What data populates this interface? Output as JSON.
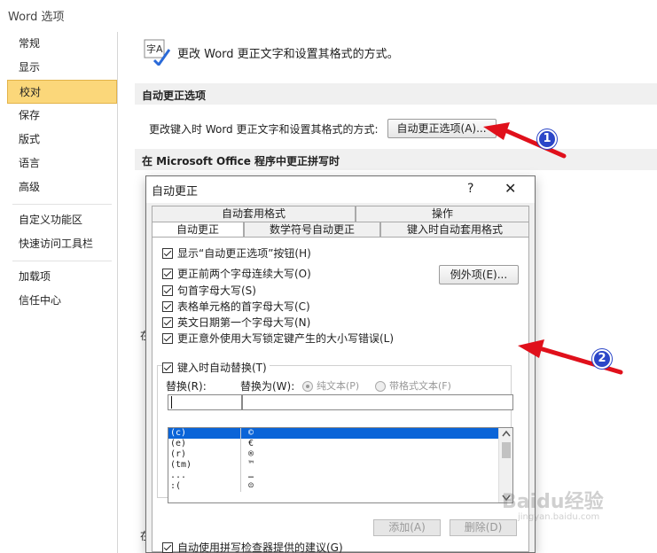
{
  "window": {
    "title": "Word 选项"
  },
  "nav": {
    "items": [
      {
        "label": "常规"
      },
      {
        "label": "显示"
      },
      {
        "label": "校对",
        "selected": true
      },
      {
        "label": "保存"
      },
      {
        "label": "版式"
      },
      {
        "label": "语言"
      },
      {
        "label": "高级"
      }
    ],
    "items2": [
      {
        "label": "自定义功能区"
      },
      {
        "label": "快速访问工具栏"
      }
    ],
    "items3": [
      {
        "label": "加载项"
      },
      {
        "label": "信任中心"
      }
    ]
  },
  "main": {
    "header_text": "更改 Word 更正文字和设置其格式的方式。",
    "icon_text": "字A",
    "section_autocorrect": "自动更正选项",
    "ac_row_label": "更改键入时 Word 更正文字和设置其格式的方式:",
    "ac_button": "自动更正选项(A)...",
    "section_spelling": "在 Microsoft Office 程序中更正拼写时",
    "stray1": "在",
    "stray2": "在"
  },
  "dialog": {
    "title": "自动更正",
    "help": "?",
    "close": "✕",
    "tabs_top": [
      "自动套用格式",
      "操作"
    ],
    "tabs_bottom": [
      "自动更正",
      "数学符号自动更正",
      "键入时自动套用格式"
    ],
    "show_button_label": "显示“自动更正选项”按钮(H)",
    "options": [
      "更正前两个字母连续大写(O)",
      "句首字母大写(S)",
      "表格单元格的首字母大写(C)",
      "英文日期第一个字母大写(N)",
      "更正意外使用大写锁定键产生的大小写错误(L)"
    ],
    "exceptions_button": "例外项(E)...",
    "replace_group_label": "键入时自动替换(T)",
    "replace_label": "替换(R):",
    "with_label": "替换为(W):",
    "radio_plain": "纯文本(P)",
    "radio_formatted": "带格式文本(F)",
    "list_rows": [
      {
        "a": "(c)",
        "b": "©",
        "selected": true
      },
      {
        "a": "(e)",
        "b": "€"
      },
      {
        "a": "(r)",
        "b": "®"
      },
      {
        "a": "(tm)",
        "b": "™"
      },
      {
        "a": "...",
        "b": "…"
      },
      {
        "a": ":(",
        "b": "☹"
      }
    ],
    "add_button": "添加(A)",
    "delete_button": "删除(D)",
    "spell_suggest": "自动使用拼写检查器提供的建议(G)"
  },
  "annotations": {
    "badge1": "1",
    "badge2": "2"
  },
  "watermark": {
    "main": "Baidu经验",
    "sub": "jingyan.baidu.com"
  },
  "colors": {
    "selected_nav": "#fbd77a",
    "arrow": "#e0101b",
    "badge": "#2b46c8",
    "list_selection": "#0a64d8"
  }
}
